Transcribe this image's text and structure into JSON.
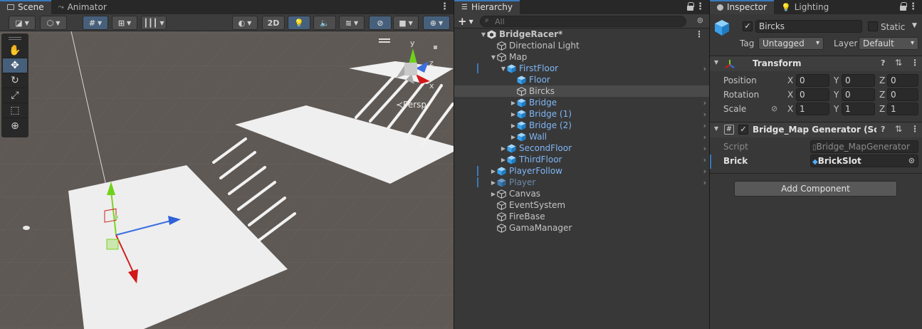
{
  "scene_tabs": {
    "scene": "Scene",
    "animator": "Animator"
  },
  "scene": {
    "mode_2d": "2D",
    "persp_label": "≺Persp",
    "gizmo_axes": {
      "y": "y",
      "x": "x",
      "z": "z"
    },
    "tool_icons": [
      "hand-tool-icon",
      "move-tool-icon",
      "rotate-tool-icon",
      "scale-tool-icon",
      "rect-tool-icon",
      "transform-tool-icon"
    ]
  },
  "hierarchy": {
    "tab": "Hierarchy",
    "add": "+",
    "search_placeholder": "All",
    "rows": [
      {
        "label": "BridgeRacer*",
        "depth": 0,
        "arrow": "▼",
        "icon": "unity-scene-icon",
        "cls": "",
        "chev": false,
        "bar": false
      },
      {
        "label": "Directional Light",
        "depth": 1,
        "arrow": "",
        "icon": "gameobject-icon",
        "cls": "",
        "chev": false,
        "bar": false
      },
      {
        "label": "Map",
        "depth": 1,
        "arrow": "▼",
        "icon": "gameobject-icon",
        "cls": "",
        "chev": false,
        "bar": false
      },
      {
        "label": "FirstFloor",
        "depth": 2,
        "arrow": "▼",
        "icon": "prefab-icon",
        "cls": "blue",
        "chev": true,
        "bar": true
      },
      {
        "label": "Floor",
        "depth": 3,
        "arrow": "",
        "icon": "prefab-icon",
        "cls": "blue",
        "chev": false,
        "bar": false
      },
      {
        "label": "Bircks",
        "depth": 3,
        "arrow": "",
        "icon": "gameobject-icon",
        "cls": "",
        "chev": false,
        "bar": false,
        "sel": true
      },
      {
        "label": "Bridge",
        "depth": 3,
        "arrow": "▶",
        "icon": "prefab-icon",
        "cls": "blue",
        "chev": true,
        "bar": false
      },
      {
        "label": "Bridge (1)",
        "depth": 3,
        "arrow": "▶",
        "icon": "prefab-icon",
        "cls": "blue",
        "chev": true,
        "bar": false
      },
      {
        "label": "Bridge (2)",
        "depth": 3,
        "arrow": "▶",
        "icon": "prefab-icon",
        "cls": "blue",
        "chev": true,
        "bar": false
      },
      {
        "label": "Wall",
        "depth": 3,
        "arrow": "▶",
        "icon": "prefab-icon",
        "cls": "blue",
        "chev": true,
        "bar": false
      },
      {
        "label": "SecondFloor",
        "depth": 2,
        "arrow": "▶",
        "icon": "prefab-icon",
        "cls": "blue",
        "chev": true,
        "bar": false
      },
      {
        "label": "ThirdFloor",
        "depth": 2,
        "arrow": "▶",
        "icon": "prefab-icon",
        "cls": "blue",
        "chev": true,
        "bar": false
      },
      {
        "label": "PlayerFollow",
        "depth": 1,
        "arrow": "▶",
        "icon": "prefab-icon",
        "cls": "blue",
        "chev": true,
        "bar": true
      },
      {
        "label": "Player",
        "depth": 1,
        "arrow": "▶",
        "icon": "prefab-icon",
        "cls": "faded",
        "chev": true,
        "bar": true
      },
      {
        "label": "Canvas",
        "depth": 1,
        "arrow": "▶",
        "icon": "gameobject-icon",
        "cls": "",
        "chev": false,
        "bar": false
      },
      {
        "label": "EventSystem",
        "depth": 1,
        "arrow": "",
        "icon": "gameobject-icon",
        "cls": "",
        "chev": false,
        "bar": false
      },
      {
        "label": "FireBase",
        "depth": 1,
        "arrow": "",
        "icon": "gameobject-icon",
        "cls": "",
        "chev": false,
        "bar": false
      },
      {
        "label": "GamaManager",
        "depth": 1,
        "arrow": "",
        "icon": "gameobject-icon",
        "cls": "",
        "chev": false,
        "bar": false
      }
    ]
  },
  "inspector": {
    "tabs": {
      "inspector": "Inspector",
      "lighting": "Lighting"
    },
    "object_name": "Bircks",
    "static_label": "Static",
    "tag_label": "Tag",
    "tag_value": "Untagged",
    "layer_label": "Layer",
    "layer_value": "Default",
    "transform": {
      "title": "Transform",
      "rows": [
        {
          "label": "Position",
          "x": "0",
          "y": "0",
          "z": "0"
        },
        {
          "label": "Rotation",
          "x": "0",
          "y": "0",
          "z": "0"
        },
        {
          "label": "Scale",
          "x": "1",
          "y": "1",
          "z": "1"
        }
      ],
      "axis": {
        "x": "X",
        "y": "Y",
        "z": "Z"
      }
    },
    "script_comp": {
      "title": "Bridge_Map Generator (Script)",
      "script_label": "Script",
      "script_value": "Bridge_MapGenerator",
      "brick_label": "Brick",
      "brick_value": "BrickSlot"
    },
    "add_component": "Add Component"
  },
  "colors": {
    "accent": "#3a79bb",
    "prefab": "#7fb6f5",
    "panel": "#383838"
  }
}
